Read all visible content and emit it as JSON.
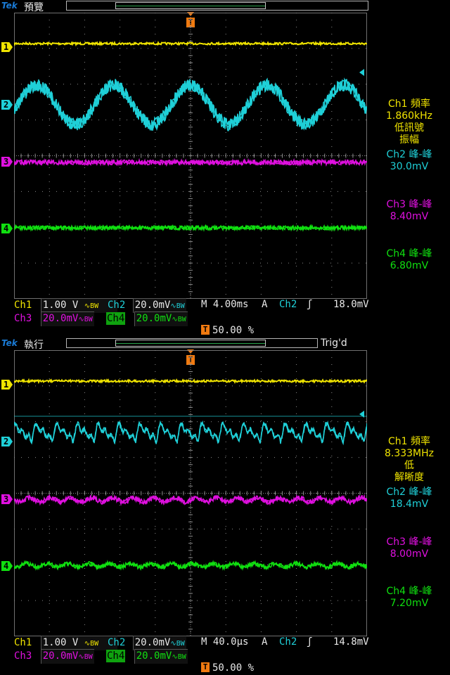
{
  "colors": {
    "ch1": "#f0e400",
    "ch2": "#1fd0d8",
    "ch3": "#e010e0",
    "ch4": "#10e010",
    "grid": "#8a8a8a",
    "trigger": "#f07a10",
    "brand": "#1a7bd6"
  },
  "screens": [
    {
      "brand": "Tek",
      "mode": "預覽",
      "trig_status": "",
      "trig_marker": "T",
      "channel_markers": [
        "1",
        "2",
        "3",
        "4"
      ],
      "measurements": [
        {
          "label": "Ch1 頻率",
          "lines": [
            "1.860kHz",
            "低訊號",
            "振幅"
          ],
          "channel": "ch1"
        },
        {
          "label": "Ch2 峰-峰",
          "lines": [
            "30.0mV"
          ],
          "channel": "ch2"
        },
        {
          "label": "Ch3 峰-峰",
          "lines": [
            "8.40mV"
          ],
          "channel": "ch3"
        },
        {
          "label": "Ch4 峰-峰",
          "lines": [
            "6.80mV"
          ],
          "channel": "ch4"
        }
      ],
      "row1": {
        "ch1_label": "Ch1",
        "ch1_scale": "1.00 V",
        "ch1_coupling": "∿BW",
        "ch2_label": "Ch2",
        "ch2_scale": "20.0mV",
        "ch2_coupling": "∿BW",
        "timebase": "M 4.00ms",
        "trig_source_mode": "A",
        "trig_channel": "Ch2",
        "trig_slope": "ʃ",
        "trig_level": "18.0mV"
      },
      "row2": {
        "ch3_label": "Ch3",
        "ch3_scale": "20.0mV",
        "ch3_coupling": "∿BW",
        "ch4_label": "Ch4",
        "ch4_scale": "20.0mV",
        "ch4_coupling": "∿BW"
      },
      "trig_position": "50.00 %",
      "trig_pos_icon": "T",
      "waves": {
        "ch2_cycles": 4.6,
        "ch2_amp_div": 0.55,
        "ch2_noise_div": 0.35,
        "ch2_shape": "sine"
      }
    },
    {
      "brand": "Tek",
      "mode": "執行",
      "trig_status": "Trig'd",
      "trig_marker": "T",
      "channel_markers": [
        "1",
        "2",
        "3",
        "4"
      ],
      "measurements": [
        {
          "label": "Ch1 頻率",
          "lines": [
            "8.333MHz",
            "低",
            "解晰度"
          ],
          "channel": "ch1"
        },
        {
          "label": "Ch2 峰-峰",
          "lines": [
            "18.4mV"
          ],
          "channel": "ch2"
        },
        {
          "label": "Ch3 峰-峰",
          "lines": [
            "8.00mV"
          ],
          "channel": "ch3"
        },
        {
          "label": "Ch4 峰-峰",
          "lines": [
            "7.20mV"
          ],
          "channel": "ch4"
        }
      ],
      "row1": {
        "ch1_label": "Ch1",
        "ch1_scale": "1.00 V",
        "ch1_coupling": "∿BW",
        "ch2_label": "Ch2",
        "ch2_scale": "20.0mV",
        "ch2_coupling": "∿BW",
        "timebase": "M 40.0µs",
        "trig_source_mode": "A",
        "trig_channel": "Ch2",
        "trig_slope": "ʃ",
        "trig_level": "14.8mV"
      },
      "row2": {
        "ch3_label": "Ch3",
        "ch3_scale": "20.0mV",
        "ch3_coupling": "∿BW",
        "ch4_label": "Ch4",
        "ch4_scale": "20.0mV",
        "ch4_coupling": "∿BW"
      },
      "trig_position": "50.00 %",
      "trig_pos_icon": "T",
      "waves": {
        "ch2_cycles": 17,
        "ch2_amp_div": 0.35,
        "ch2_noise_div": 0.12,
        "ch2_shape": "saw"
      }
    }
  ]
}
